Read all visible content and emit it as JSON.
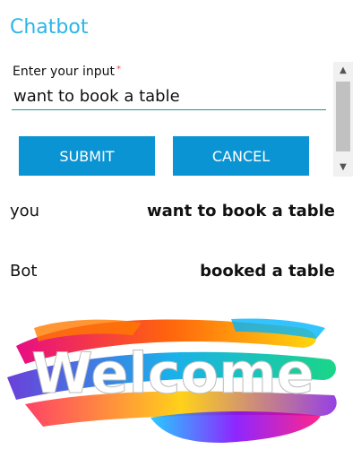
{
  "app": {
    "title": "Chatbot"
  },
  "form": {
    "input_label": "Enter your input",
    "required_mark": "*",
    "input_value": "want to book a table",
    "submit_label": "SUBMIT",
    "cancel_label": "CANCEL"
  },
  "scrollbar": {
    "up_arrow": "▲",
    "down_arrow": "▼"
  },
  "messages": [
    {
      "sender": "you",
      "text": "want to book a table"
    },
    {
      "sender": "Bot",
      "text": "booked a table"
    }
  ],
  "banner": {
    "text": "Welcome",
    "icon": "welcome-paint-banner"
  },
  "colors": {
    "title": "#2bb5e8",
    "button": "#0a94d3",
    "input_underline": "#1a9a86"
  }
}
